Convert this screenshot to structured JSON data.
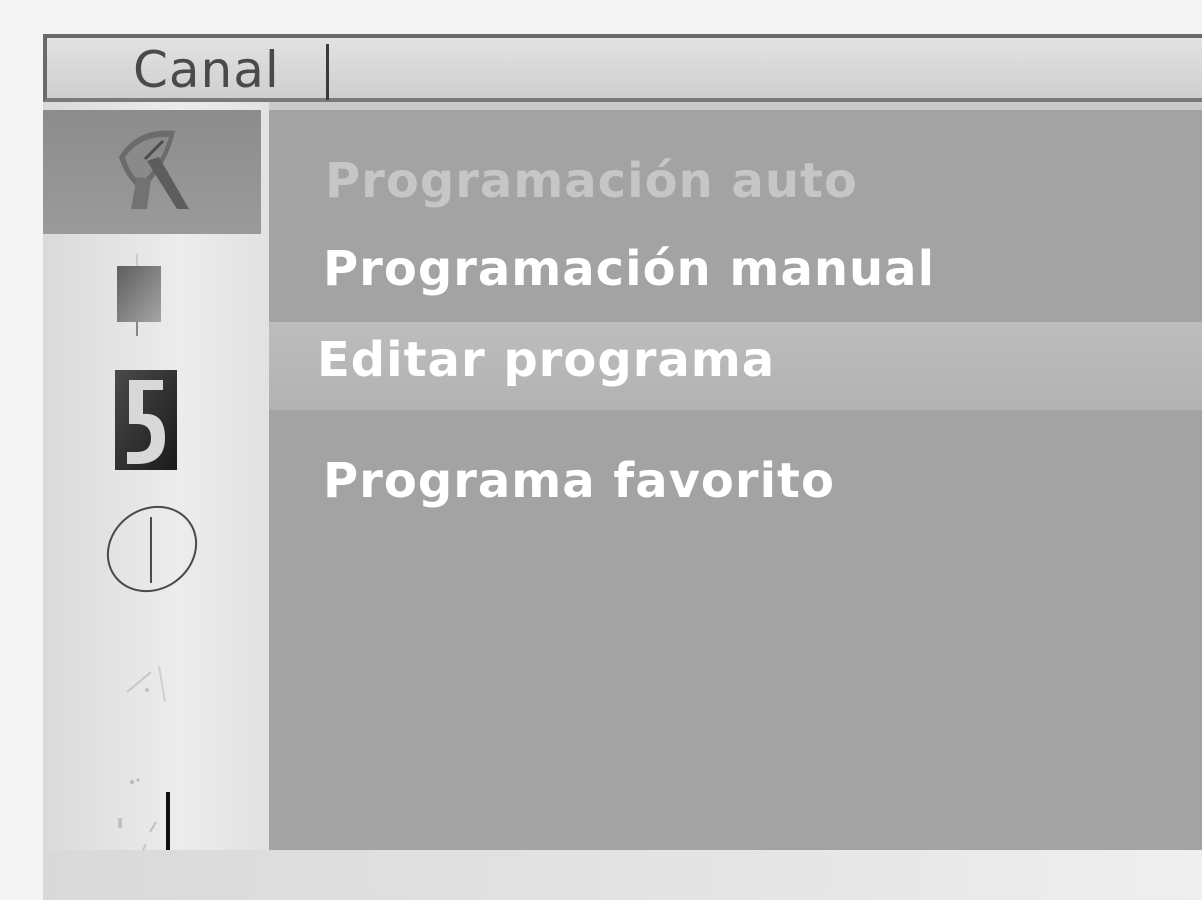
{
  "header": {
    "title": "Canal"
  },
  "sidebar": {
    "items": [
      {
        "icon": "satellite-dish-icon",
        "selected": true
      },
      {
        "icon": "picture-icon",
        "selected": false
      },
      {
        "icon": "lock-icon",
        "selected": false
      },
      {
        "icon": "time-icon",
        "selected": false
      },
      {
        "icon": "option-icon",
        "selected": false
      },
      {
        "icon": "sound-icon",
        "selected": false
      }
    ]
  },
  "menu": {
    "items": [
      {
        "label": "Programación auto",
        "state": "disabled"
      },
      {
        "label": "Programación manual",
        "state": "normal"
      },
      {
        "label": "Editar programa",
        "state": "highlighted"
      },
      {
        "label": "Programa favorito",
        "state": "normal"
      }
    ]
  },
  "colors": {
    "panel": "#a3a3a3",
    "highlight": "#b8b8b8",
    "text": "#ffffff",
    "text_disabled": "#c6c6c6"
  }
}
